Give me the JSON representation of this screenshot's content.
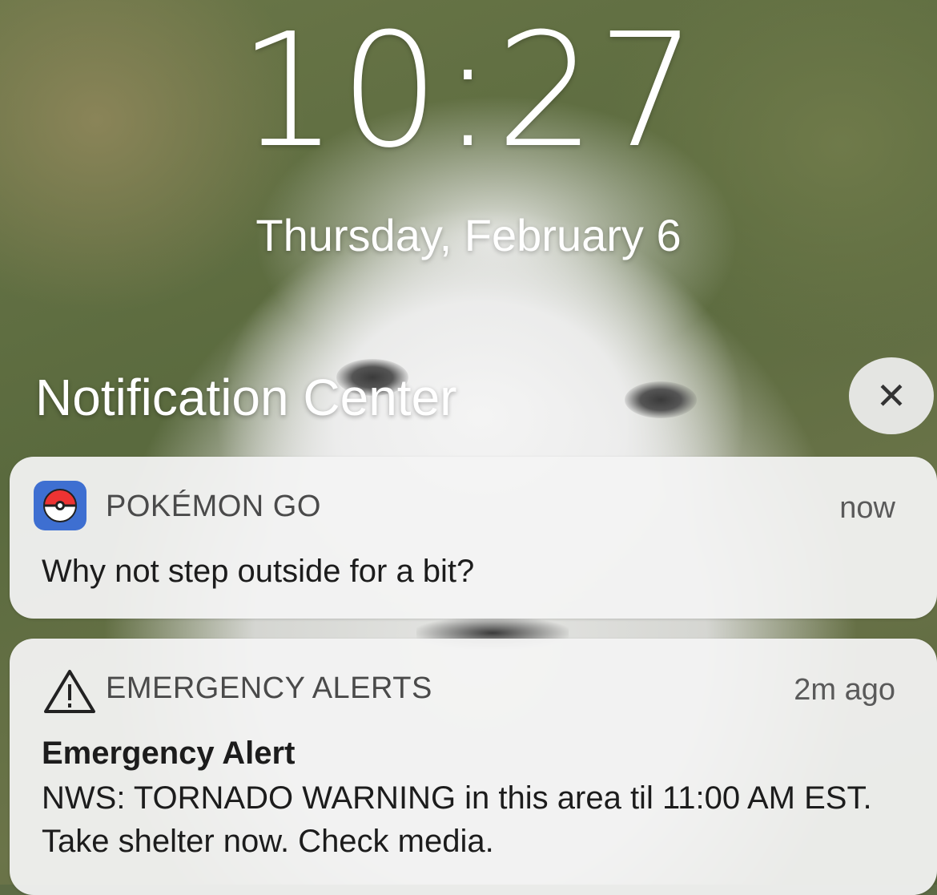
{
  "lockscreen": {
    "time": "10:27",
    "date": "Thursday, February 6"
  },
  "notification_center": {
    "title": "Notification Center",
    "close_glyph": "✕"
  },
  "notifications": [
    {
      "app": "POKÉMON GO",
      "icon": "pokeball-icon",
      "time": "now",
      "message": "Why not step outside for a bit?"
    },
    {
      "app": "EMERGENCY ALERTS",
      "icon": "warning-triangle-icon",
      "time": "2m ago",
      "title": "Emergency Alert",
      "message": "NWS: TORNADO WARNING in this area til 11:00 AM EST. Take shelter now. Check media."
    }
  ],
  "colors": {
    "card_bg": "#f3f3f3",
    "text_primary": "#1c1c1c",
    "text_secondary": "#4a4a4a",
    "pokemon_icon_blue": "#3e6fd1"
  }
}
